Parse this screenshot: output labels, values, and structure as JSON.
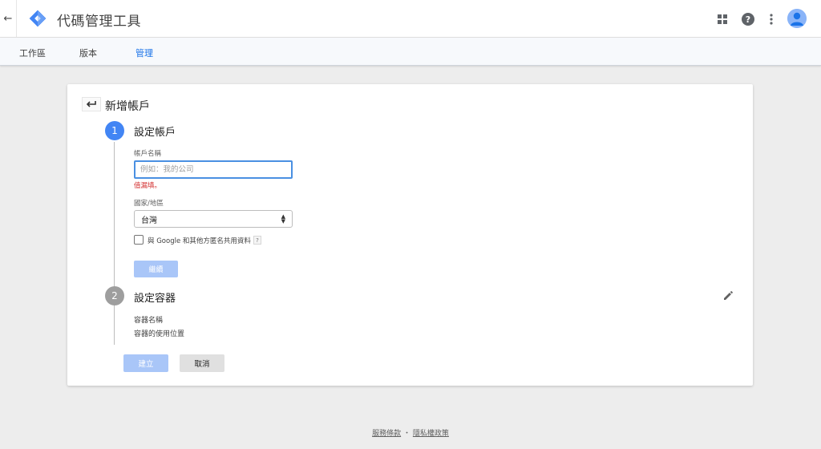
{
  "header": {
    "back_icon": "arrow-left",
    "app_title": "代碼管理工具",
    "logo_color": "#4285f4",
    "icons": [
      "apps-grid-icon",
      "help-icon",
      "more-vert-icon",
      "account-avatar"
    ]
  },
  "tabs": [
    {
      "label": "工作區",
      "active": false
    },
    {
      "label": "版本",
      "active": false
    },
    {
      "label": "管理",
      "active": true
    }
  ],
  "card": {
    "title": "新增帳戶",
    "step1": {
      "number": "1",
      "title": "設定帳戶",
      "account_name_label": "帳戶名稱",
      "account_name_value": "",
      "account_name_placeholder": "例如：我的公司",
      "required_msg": "值漏填。",
      "country_label": "國家/地區",
      "country_value": "台灣",
      "share_data_checked": false,
      "share_data_label": "與 Google 和其他方匿名共用資料",
      "help_mark": "?",
      "continue_label": "繼續"
    },
    "step2": {
      "number": "2",
      "title": "設定容器",
      "container_name_label": "容器名稱",
      "container_usage_label": "容器的使用位置"
    },
    "create_label": "建立",
    "cancel_label": "取消"
  },
  "footer": {
    "terms": "服務條款",
    "separator": "・",
    "privacy": "隱私權政策"
  },
  "colors": {
    "accent": "#4285f4",
    "active_tab": "#1a73e8",
    "error": "#d32f2f",
    "disabled_button": "#a9c6f8"
  }
}
